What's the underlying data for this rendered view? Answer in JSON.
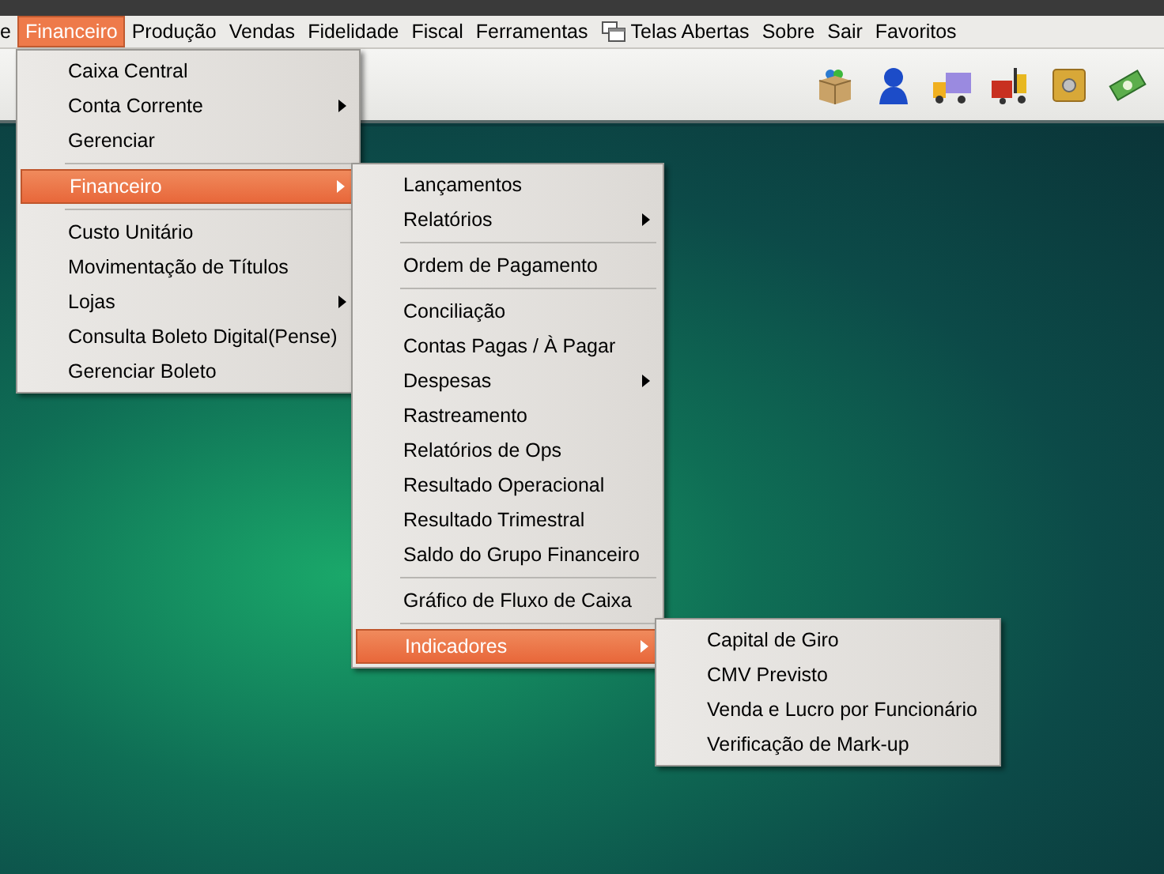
{
  "menubar": [
    {
      "label": "e",
      "selected": false
    },
    {
      "label": "Financeiro",
      "selected": true
    },
    {
      "label": "Produção",
      "selected": false
    },
    {
      "label": "Vendas",
      "selected": false
    },
    {
      "label": "Fidelidade",
      "selected": false
    },
    {
      "label": "Fiscal",
      "selected": false
    },
    {
      "label": "Ferramentas",
      "selected": false
    },
    {
      "label": "Telas Abertas",
      "selected": false
    },
    {
      "label": "Sobre",
      "selected": false
    },
    {
      "label": "Sair",
      "selected": false
    },
    {
      "label": "Favoritos",
      "selected": false
    }
  ],
  "menus": [
    {
      "items": [
        {
          "kind": "item",
          "label": "Caixa Central",
          "submenu": false,
          "selected": false
        },
        {
          "kind": "item",
          "label": "Conta Corrente",
          "submenu": true,
          "selected": false
        },
        {
          "kind": "item",
          "label": "Gerenciar",
          "submenu": false,
          "selected": false
        },
        {
          "kind": "separator"
        },
        {
          "kind": "item",
          "label": "Financeiro",
          "submenu": true,
          "selected": true
        },
        {
          "kind": "separator"
        },
        {
          "kind": "item",
          "label": "Custo Unitário",
          "submenu": false,
          "selected": false
        },
        {
          "kind": "item",
          "label": "Movimentação de Títulos",
          "submenu": false,
          "selected": false
        },
        {
          "kind": "item",
          "label": "Lojas",
          "submenu": true,
          "selected": false
        },
        {
          "kind": "item",
          "label": "Consulta Boleto Digital(Pense)",
          "submenu": false,
          "selected": false
        },
        {
          "kind": "item",
          "label": "Gerenciar Boleto",
          "submenu": false,
          "selected": false
        }
      ]
    },
    {
      "items": [
        {
          "kind": "item",
          "label": "Lançamentos",
          "submenu": false,
          "selected": false
        },
        {
          "kind": "item",
          "label": "Relatórios",
          "submenu": true,
          "selected": false
        },
        {
          "kind": "separator"
        },
        {
          "kind": "item",
          "label": "Ordem de Pagamento",
          "submenu": false,
          "selected": false
        },
        {
          "kind": "separator"
        },
        {
          "kind": "item",
          "label": "Conciliação",
          "submenu": false,
          "selected": false
        },
        {
          "kind": "item",
          "label": "Contas Pagas / À Pagar",
          "submenu": false,
          "selected": false
        },
        {
          "kind": "item",
          "label": "Despesas",
          "submenu": true,
          "selected": false
        },
        {
          "kind": "item",
          "label": "Rastreamento",
          "submenu": false,
          "selected": false
        },
        {
          "kind": "item",
          "label": "Relatórios de Ops",
          "submenu": false,
          "selected": false
        },
        {
          "kind": "item",
          "label": "Resultado Operacional",
          "submenu": false,
          "selected": false
        },
        {
          "kind": "item",
          "label": "Resultado Trimestral",
          "submenu": false,
          "selected": false
        },
        {
          "kind": "item",
          "label": "Saldo do Grupo Financeiro",
          "submenu": false,
          "selected": false
        },
        {
          "kind": "separator"
        },
        {
          "kind": "item",
          "label": "Gráfico de Fluxo de Caixa",
          "submenu": false,
          "selected": false
        },
        {
          "kind": "separator"
        },
        {
          "kind": "item",
          "label": "Indicadores",
          "submenu": true,
          "selected": true
        }
      ]
    },
    {
      "items": [
        {
          "kind": "item",
          "label": "Capital de Giro",
          "submenu": false,
          "selected": false
        },
        {
          "kind": "item",
          "label": "CMV Previsto",
          "submenu": false,
          "selected": false
        },
        {
          "kind": "item",
          "label": "Venda e Lucro por Funcionário",
          "submenu": false,
          "selected": false
        },
        {
          "kind": "item",
          "label": "Verificação de Mark-up",
          "submenu": false,
          "selected": false
        }
      ]
    }
  ]
}
